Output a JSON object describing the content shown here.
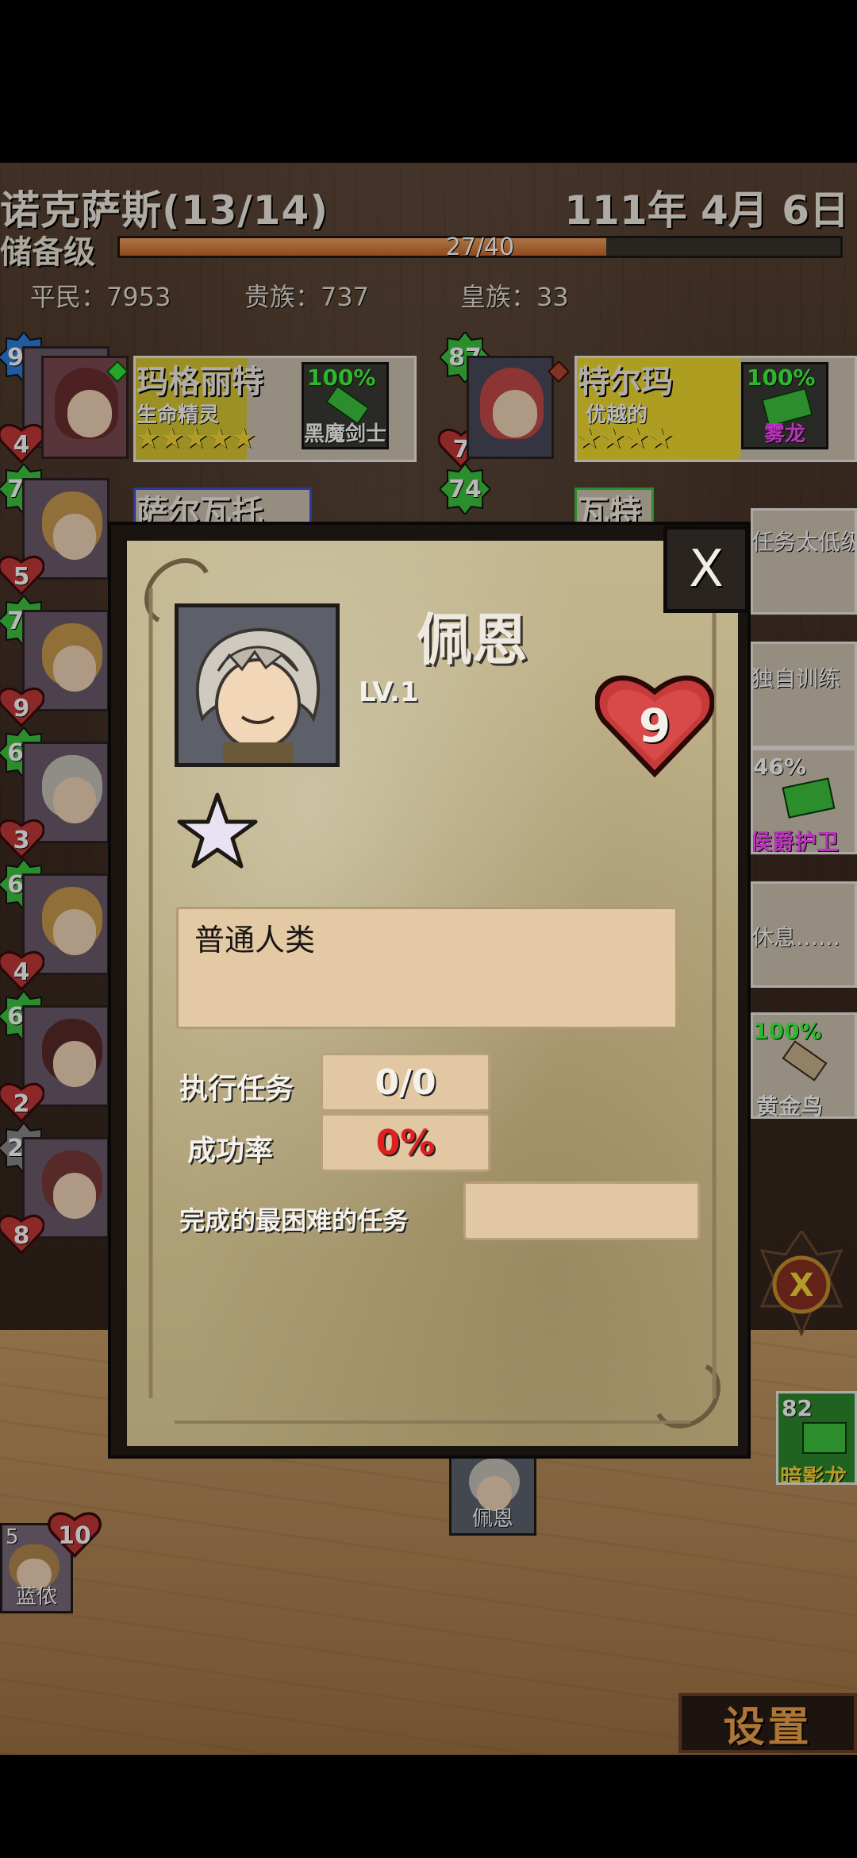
{
  "header": {
    "kingdom": "诺克萨斯(13/14)",
    "date": "111年 4月 6日",
    "rank": "储备级",
    "xp_text": "27/40",
    "xp_fraction": 0.675
  },
  "population": {
    "commoners": "平民：7953",
    "nobles": "贵族：737",
    "royals": "皇族：33"
  },
  "roster_left": [
    {
      "level": "95",
      "heart": "4",
      "badge_color": "#2d7de0"
    },
    {
      "level": "77",
      "heart": "5",
      "badge_color": "#3ec43e"
    },
    {
      "level": "73",
      "heart": "9",
      "badge_color": "#3ec43e"
    },
    {
      "level": "69",
      "heart": "3",
      "badge_color": "#3ec43e"
    },
    {
      "level": "68",
      "heart": "4",
      "badge_color": "#3ec43e"
    },
    {
      "level": "62",
      "heart": "2",
      "badge_color": "#3ec43e"
    },
    {
      "level": "20",
      "heart": "8",
      "badge_color": "#888888"
    }
  ],
  "roster_right": [
    {
      "level": "87",
      "heart": "7"
    },
    {
      "level": "74",
      "heart": ""
    }
  ],
  "cards": {
    "c1": {
      "name": "玛格丽特",
      "trait": "生命精灵",
      "stars": "★★★★★",
      "skill_pct": "100%",
      "skill_name": "黑魔剑士"
    },
    "c2": {
      "name": "特尔玛",
      "trait": "优越的",
      "stars": "★★★★",
      "skill_pct": "100%",
      "skill_name": "雾龙"
    },
    "c3": {
      "name": "萨尔瓦托"
    },
    "c4": {
      "name": "瓦特"
    }
  },
  "right_column": {
    "r1": "任务太低级",
    "r2": "独自训练",
    "r3_pct": "46%",
    "r3_name": "侯爵护卫",
    "r4": "休息……",
    "r5_pct": "100%",
    "r5_name": "黄金鸟",
    "r6_pct": "82",
    "r6_name": "暗影龙"
  },
  "floor": {
    "char_center": "佩恩",
    "char_left": "蓝侬",
    "char_left_heart": "10",
    "char_left_num": "5"
  },
  "modal": {
    "close_label": "X",
    "name": "佩恩",
    "level": "LV.1",
    "hearts": "9",
    "star_count": 1,
    "description": "普通人类",
    "missions_label": "执行任务",
    "missions_value": "0/0",
    "success_label": "成功率",
    "success_value": "0%",
    "success_color": "#e02020",
    "hardest_label": "完成的最困难的任务",
    "hardest_value": ""
  },
  "settings_label": "设置"
}
